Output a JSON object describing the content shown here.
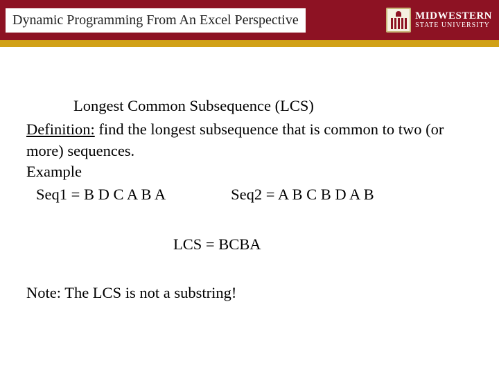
{
  "header": {
    "title": "Dynamic Programming From An Excel Perspective",
    "logo": {
      "line1": "MIDWESTERN",
      "line2": "STATE UNIVERSITY"
    }
  },
  "content": {
    "heading": "Longest Common Subsequence (LCS)",
    "def_label": "Definition:",
    "def_text": " find the longest subsequence that is common to two (or more) sequences.",
    "example_label": "Example",
    "seq1_label": "Seq1 = ",
    "seq1_value": "B D C A B A",
    "seq2_label": "Seq2 = ",
    "seq2_value": "A B C B D A B",
    "lcs_label": "LCS = ",
    "lcs_value": "BCBA",
    "note": "Note: The LCS is not a substring!"
  }
}
